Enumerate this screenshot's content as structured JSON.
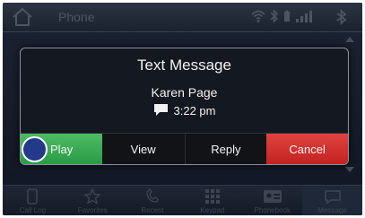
{
  "status_bar": {
    "title": "Phone",
    "icons": [
      "home-icon",
      "wifi-icon",
      "bluetooth-icon",
      "battery-icon",
      "signal-icon",
      "bluetooth-icon"
    ]
  },
  "nav": {
    "items": [
      {
        "label": "Call Log",
        "icon": "phone-icon"
      },
      {
        "label": "Favorites",
        "icon": "star-icon"
      },
      {
        "label": "Recent",
        "icon": "recent-call-icon"
      },
      {
        "label": "Keypad",
        "icon": "keypad-icon"
      },
      {
        "label": "Phonebook",
        "icon": "phonebook-icon"
      },
      {
        "label": "Message",
        "icon": "message-icon"
      }
    ]
  },
  "dialog": {
    "title": "Text Message",
    "contact": "Karen Page",
    "time": "3:22 pm",
    "buttons": {
      "play": "Play",
      "view": "View",
      "reply": "Reply",
      "cancel": "Cancel"
    }
  },
  "colors": {
    "play": "#2fa54b",
    "cancel": "#d12d29",
    "play_circle": "#233a8a"
  }
}
